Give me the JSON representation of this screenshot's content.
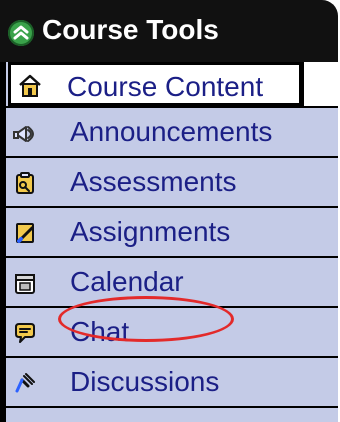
{
  "header": {
    "title": "Course Tools",
    "icon": "chevron-up-circle-icon",
    "accent": "#3aa24a"
  },
  "menu": {
    "selected": {
      "label": "Course Content",
      "icon": "home-icon"
    },
    "expand_icon": "chevron-double-down-icon",
    "items": [
      {
        "label": "Announcements",
        "icon": "megaphone-icon"
      },
      {
        "label": "Assessments",
        "icon": "assessment-icon"
      },
      {
        "label": "Assignments",
        "icon": "pencil-paper-icon"
      },
      {
        "label": "Calendar",
        "icon": "calendar-icon"
      },
      {
        "label": "Chat",
        "icon": "chat-bubble-icon"
      },
      {
        "label": "Discussions",
        "icon": "pushpin-icon"
      }
    ],
    "highlight_color": "#e32a2a",
    "label_color": "#1b1f86",
    "row_bg": "#c4cbe7"
  }
}
